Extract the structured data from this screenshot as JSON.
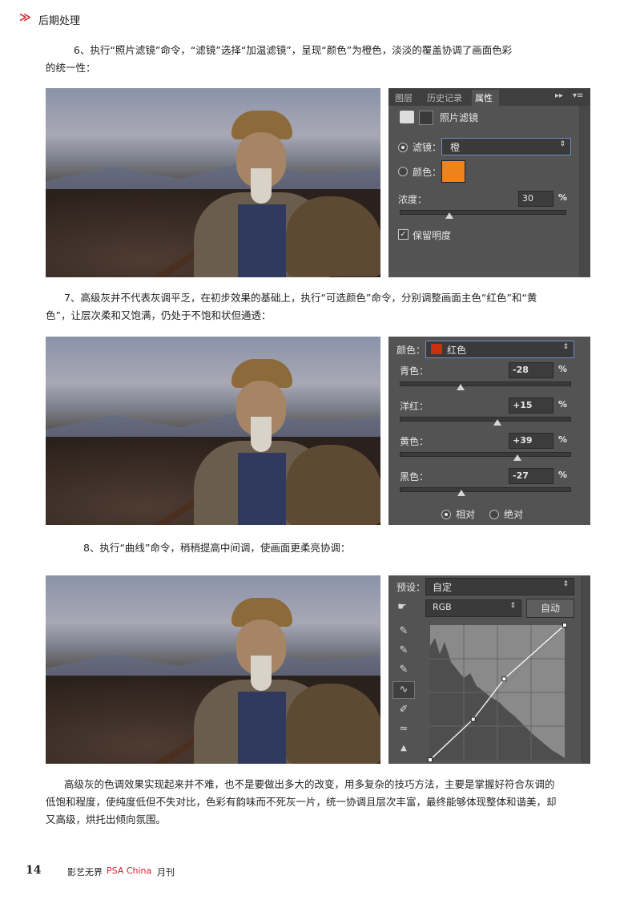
{
  "header": {
    "chevron": "≫",
    "section_title": "后期处理"
  },
  "paragraphs": {
    "step6_line1": "6、执行“照片滤镜”命令，“滤镜”选择“加温滤镜”，呈现“颜色”为橙色，淡淡的覆盖协调了画面色彩",
    "step6_line2": "的统一性：",
    "step7_line1": "7、高级灰并不代表灰调平乏，在初步效果的基础上，执行“可选颜色”命令，分别调整画面主色“红色”和“黄",
    "step7_line2": "色”，让层次柔和又饱满，仍处于不饱和状但通透：",
    "step8": "8、执行“曲线”命令，稍稍提高中间调，使画面更柔亮协调：",
    "summary_line1": "高级灰的色调效果实现起来并不难，也不是要做出多大的改变，用多复杂的技巧方法，主要是掌握好符合灰调的",
    "summary_line2": "低饱和程度，使纯度低但不失对比，色彩有韵味而不死灰一片，统一协调且层次丰富，最终能够体现整体和谐美，却",
    "summary_line3": "又高级，烘托出倾向氛围。"
  },
  "panel1": {
    "tabs": [
      "图层",
      "历史记录",
      "属性"
    ],
    "active_tab": "属性",
    "menu_glyphs": "▸▸",
    "menu_icon": "▾≡",
    "title": "照片滤镜",
    "filter_label": "滤镜：",
    "filter_value": "橙",
    "color_label": "颜色：",
    "color_swatch": "#f0821c",
    "density_label": "浓度：",
    "density_value": "30",
    "density_fraction": 0.3,
    "percent": "%",
    "preserve_label": "保留明度",
    "preserve_checked": true
  },
  "panel2": {
    "color_label": "颜色：",
    "color_value": "红色",
    "color_swatch": "#c8300e",
    "rows": [
      {
        "label": "青色：",
        "value": "-28",
        "pos": -28
      },
      {
        "label": "洋红：",
        "value": "+15",
        "pos": 15
      },
      {
        "label": "黄色：",
        "value": "+39",
        "pos": 39
      },
      {
        "label": "黑色：",
        "value": "-27",
        "pos": -27
      }
    ],
    "percent": "%",
    "relative_label": "相对",
    "absolute_label": "绝对"
  },
  "panel3": {
    "preset_label": "预设：",
    "preset_value": "自定",
    "channel_value": "RGB",
    "auto_label": "自动",
    "curve_points": [
      [
        0,
        0
      ],
      [
        0.32,
        0.3
      ],
      [
        0.55,
        0.6
      ],
      [
        1,
        1
      ]
    ]
  },
  "footer": {
    "page_number": "14",
    "publication": "影艺无界",
    "psa": "PSA China",
    "monthly": "月刊"
  },
  "colors": {
    "accent": "#d61e2a",
    "panel_bg": "#535353"
  }
}
